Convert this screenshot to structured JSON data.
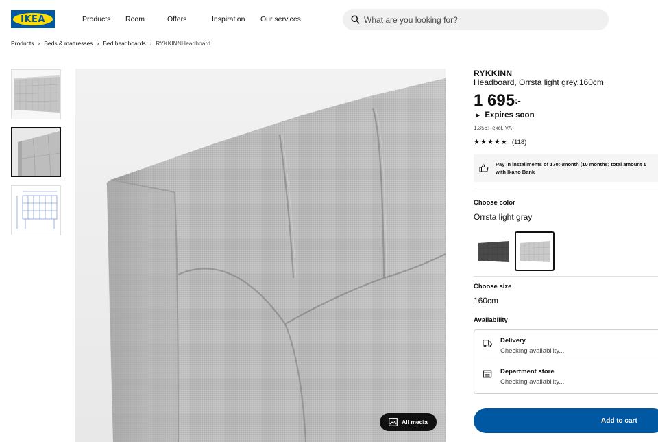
{
  "header": {
    "logo_text": "IKEA",
    "nav": [
      "Products",
      "Room",
      "Offers",
      "Inspiration",
      "Our services"
    ],
    "search_placeholder": "What are you looking for?"
  },
  "breadcrumb": [
    "Products",
    "Beds & mattresses",
    "Bed headboards",
    "RYKKINNHeadboard"
  ],
  "gallery": {
    "thumbnails": [
      "Headboard front view",
      "Headboard close-up",
      "Dimension drawing"
    ],
    "active_index": 1,
    "all_media_label": "All media"
  },
  "product": {
    "name": "RYKKINN",
    "description": "Headboard, Orrsta light grey,",
    "size_link": "160cm",
    "price": "1 695",
    "price_suffix": ":-",
    "expires": "Expires soon",
    "excl_vat": "1,356:- excl. VAT",
    "rating_stars": 4.5,
    "review_count": "(118)",
    "installment_line1": "Pay in installments of 170:-/month (10 months; total amount 1",
    "installment_line2": "with Ikano Bank"
  },
  "options": {
    "color_label": "Choose color",
    "color_value": "Orrsta light gray",
    "swatches": [
      {
        "name": "dark grey",
        "color": "#4a4a4a"
      },
      {
        "name": "light grey",
        "color": "#c9c9c9"
      }
    ],
    "selected_swatch": 1,
    "size_label": "Choose size",
    "size_value": "160cm"
  },
  "availability": {
    "label": "Availability",
    "delivery_title": "Delivery",
    "delivery_status": "Checking availability...",
    "store_title": "Department store",
    "store_status": "Checking availability..."
  },
  "cart": {
    "label": "Add to cart"
  },
  "colors": {
    "brand_blue": "#0058a3",
    "brand_yellow": "#ffdb00"
  }
}
